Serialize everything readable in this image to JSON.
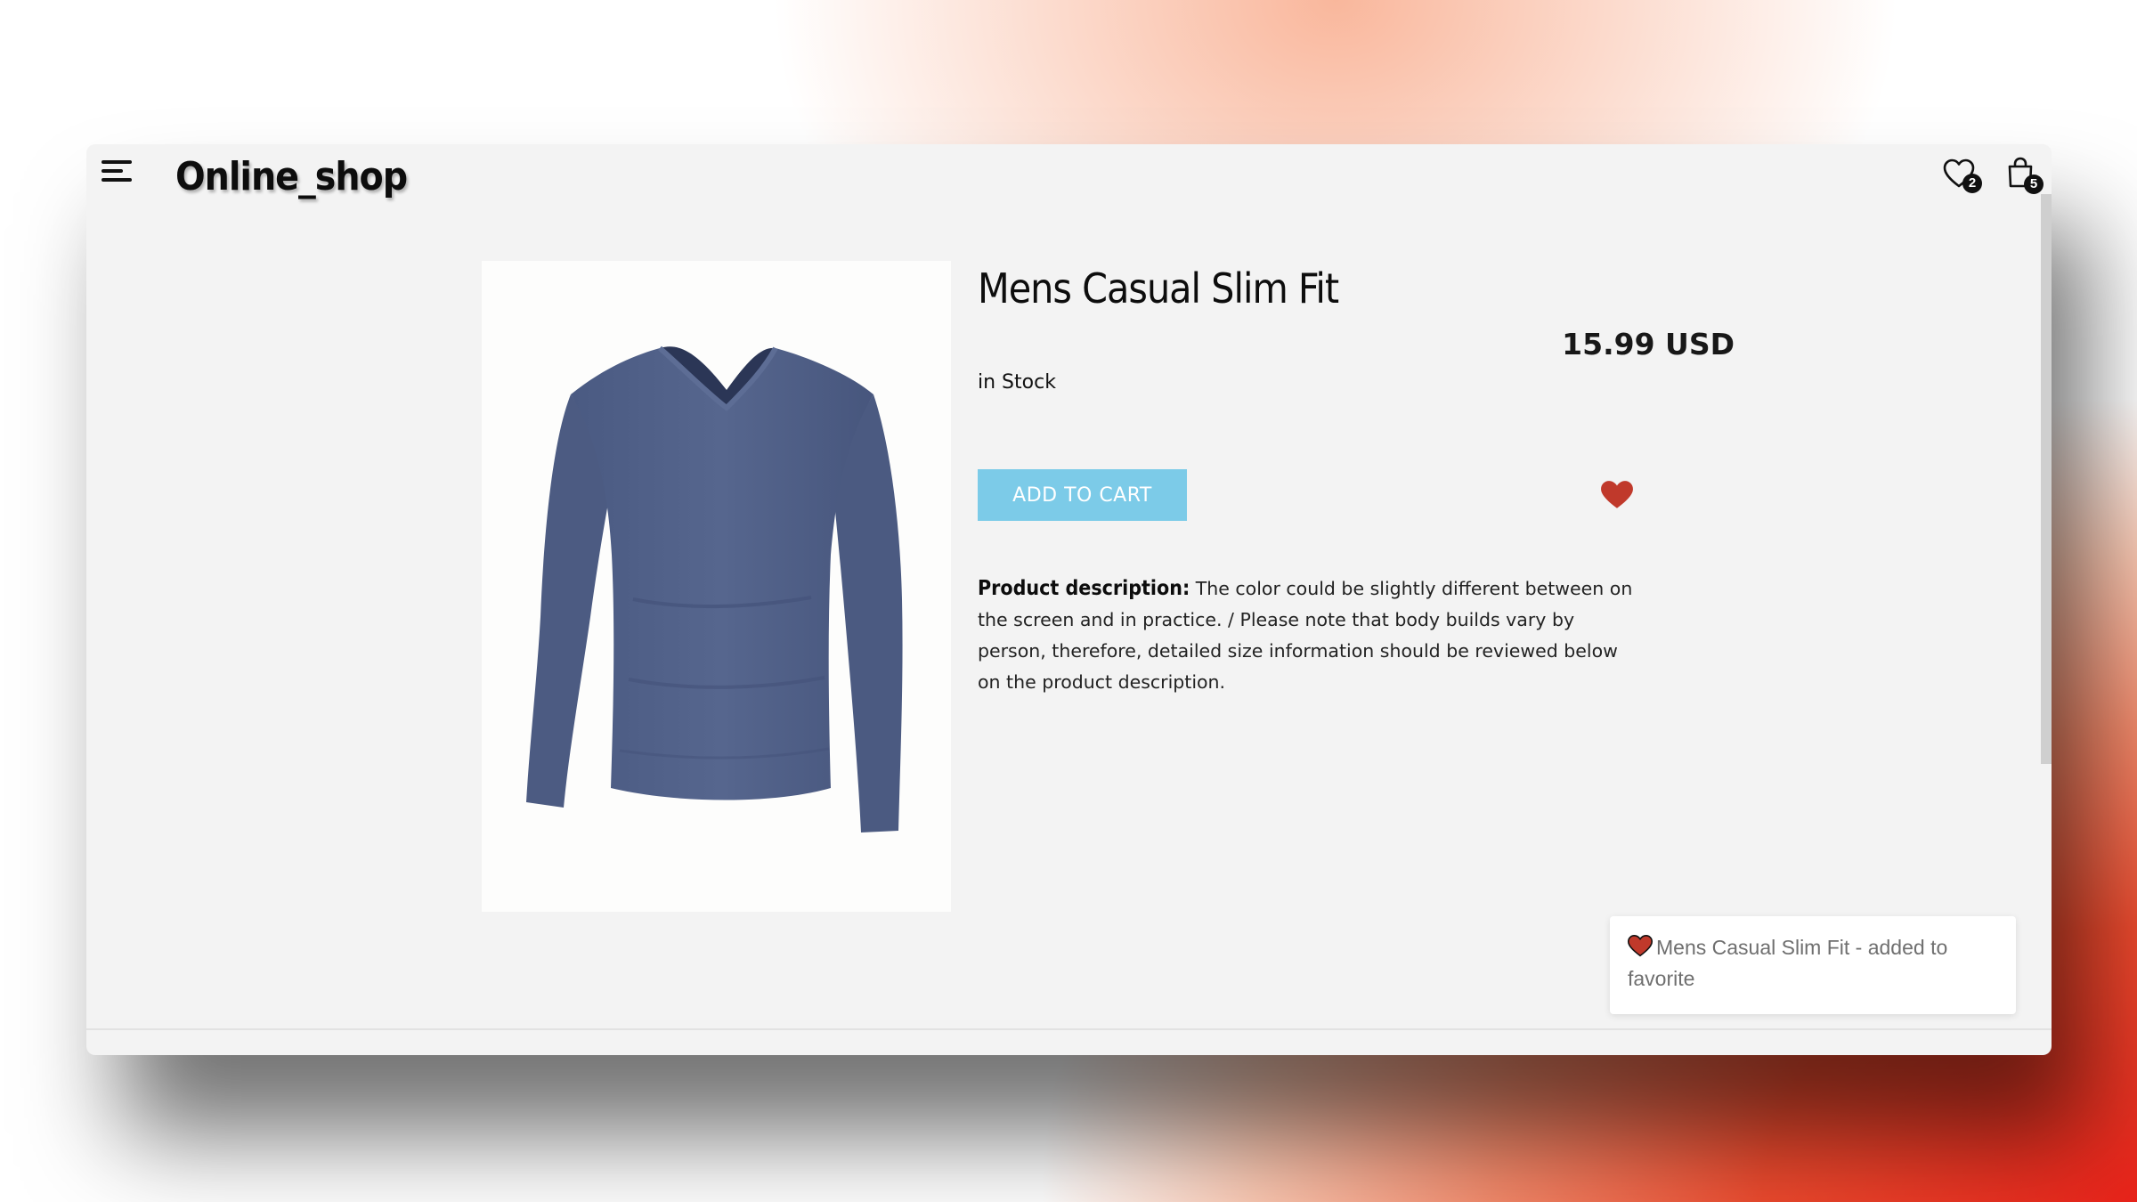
{
  "header": {
    "brand": "Online_shop",
    "favorites_count": "2",
    "cart_count": "5"
  },
  "product": {
    "title": "Mens Casual Slim Fit",
    "price": "15.99 USD",
    "stock": "in Stock",
    "add_to_cart_label": "ADD TO CART",
    "description_label": "Product description:",
    "description_text": " The color could be slightly different between on the screen and in practice. / Please note that body builds vary by person, therefore, detailed size information should be reviewed below on the product description.",
    "image_name": "blue-long-sleeve-v-neck-shirt",
    "is_favorite": true
  },
  "toast": {
    "message": "Mens Casual Slim Fit - added to favorite"
  },
  "colors": {
    "accent_button": "#7ccbe8",
    "heart": "#c0392b",
    "shirt": "#4f5f87"
  },
  "icons": {
    "menu": "hamburger-menu-icon",
    "favorites": "heart-outline-icon",
    "cart": "shopping-bag-icon",
    "favorite_toggle": "heart-filled-icon"
  }
}
